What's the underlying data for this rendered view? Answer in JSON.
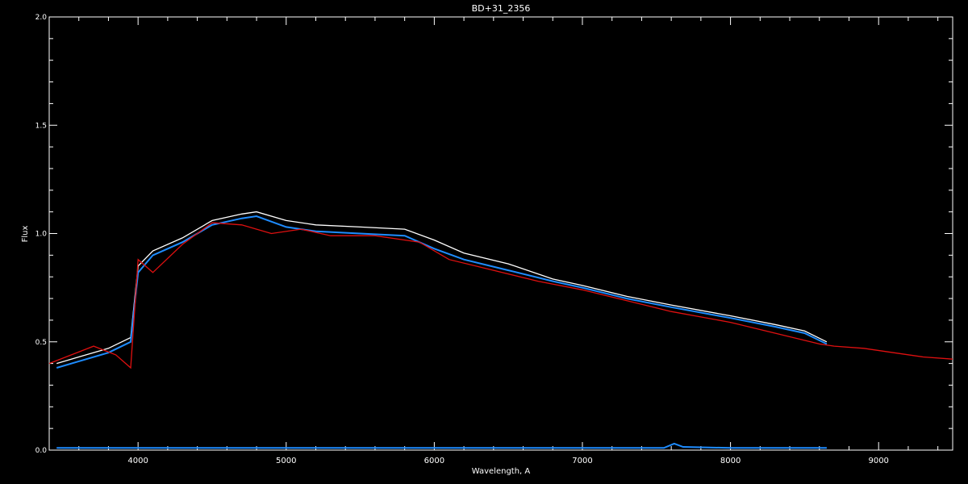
{
  "chart_data": {
    "type": "line",
    "title": "BD+31_2356",
    "xlabel": "Wavelength, A",
    "ylabel": "Flux",
    "xlim": [
      3400,
      9500
    ],
    "ylim": [
      0.0,
      2.0
    ],
    "x_ticks": [
      4000,
      5000,
      6000,
      7000,
      8000,
      9000
    ],
    "x_tick_labels": [
      "4000",
      "5000",
      "6000",
      "7000",
      "8000",
      "9000"
    ],
    "y_ticks": [
      0.0,
      0.5,
      1.0,
      1.5,
      2.0
    ],
    "y_tick_labels": [
      "0.0",
      "0.5",
      "1.0",
      "1.5",
      "2.0"
    ],
    "grid": false,
    "colors": {
      "background": "#000000",
      "axes": "#ffffff",
      "blue": "#1e8cff",
      "red": "#e01010",
      "white": "#ffffff"
    },
    "series": [
      {
        "color": "white",
        "x": [
          3450,
          3600,
          3800,
          3950,
          4000,
          4100,
          4300,
          4500,
          4700,
          4800,
          5000,
          5200,
          5500,
          5800,
          6000,
          6200,
          6500,
          6800,
          7000,
          7300,
          7600,
          8000,
          8300,
          8500,
          8650
        ],
        "y": [
          0.4,
          0.43,
          0.47,
          0.52,
          0.85,
          0.92,
          0.98,
          1.06,
          1.09,
          1.1,
          1.06,
          1.04,
          1.03,
          1.02,
          0.97,
          0.91,
          0.86,
          0.79,
          0.76,
          0.71,
          0.67,
          0.62,
          0.58,
          0.55,
          0.5
        ]
      },
      {
        "color": "blue",
        "x": [
          3450,
          3600,
          3800,
          3950,
          4000,
          4100,
          4300,
          4500,
          4700,
          4800,
          5000,
          5200,
          5500,
          5800,
          6000,
          6200,
          6500,
          6800,
          7000,
          7300,
          7600,
          8000,
          8300,
          8500,
          8650
        ],
        "y": [
          0.38,
          0.41,
          0.45,
          0.5,
          0.82,
          0.9,
          0.96,
          1.04,
          1.07,
          1.08,
          1.03,
          1.01,
          1.0,
          0.99,
          0.93,
          0.88,
          0.83,
          0.78,
          0.75,
          0.7,
          0.66,
          0.61,
          0.57,
          0.54,
          0.49
        ]
      },
      {
        "color": "red",
        "x": [
          3400,
          3550,
          3700,
          3850,
          3950,
          4000,
          4100,
          4300,
          4500,
          4700,
          4900,
          5100,
          5300,
          5600,
          5900,
          6100,
          6400,
          6700,
          7000,
          7300,
          7600,
          8000,
          8300,
          8600,
          8700,
          8900,
          9100,
          9300,
          9500
        ],
        "y": [
          0.4,
          0.44,
          0.48,
          0.44,
          0.38,
          0.88,
          0.82,
          0.95,
          1.05,
          1.04,
          1.0,
          1.02,
          0.99,
          0.99,
          0.96,
          0.88,
          0.83,
          0.78,
          0.74,
          0.69,
          0.64,
          0.59,
          0.54,
          0.49,
          0.48,
          0.47,
          0.45,
          0.43,
          0.42
        ]
      },
      {
        "color": "blue",
        "x": [
          3450,
          5000,
          6500,
          7550,
          7620,
          7680,
          8000,
          8650
        ],
        "y": [
          0.01,
          0.01,
          0.01,
          0.01,
          0.03,
          0.015,
          0.01,
          0.01
        ]
      }
    ]
  }
}
